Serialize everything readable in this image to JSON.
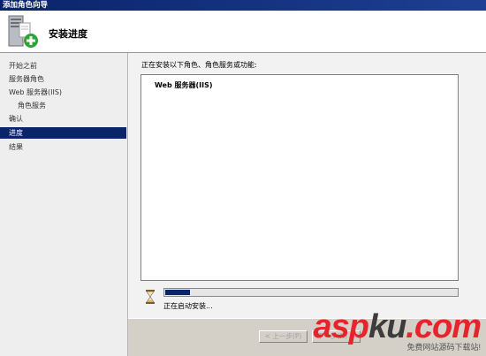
{
  "window": {
    "title": "添加角色向导"
  },
  "header": {
    "title": "安装进度"
  },
  "sidebar": {
    "items": [
      {
        "label": "开始之前"
      },
      {
        "label": "服务器角色"
      },
      {
        "label": "Web 服务器(IIS)"
      },
      {
        "label": "角色服务"
      },
      {
        "label": "确认"
      },
      {
        "label": "进度"
      },
      {
        "label": "结果"
      }
    ]
  },
  "main": {
    "intro": "正在安装以下角色、角色服务或功能:",
    "list": [
      "Web 服务器(IIS)"
    ],
    "progress": 0.09,
    "status": "正在启动安装..."
  },
  "footer": {
    "prev": "< 上一步(P)",
    "next": "下一步(N) >"
  },
  "watermark": {
    "logo_a": "asp",
    "logo_b": "ku",
    "logo_c": ".com",
    "sub": "免费网站源码下载站!"
  },
  "colors": {
    "titlebar": "#0a246a",
    "selection": "#0a246a",
    "progress_fill": "#0a246a",
    "watermark_red": "#e8232c"
  },
  "icons": [
    "server-wizard-icon",
    "hourglass-icon"
  ]
}
